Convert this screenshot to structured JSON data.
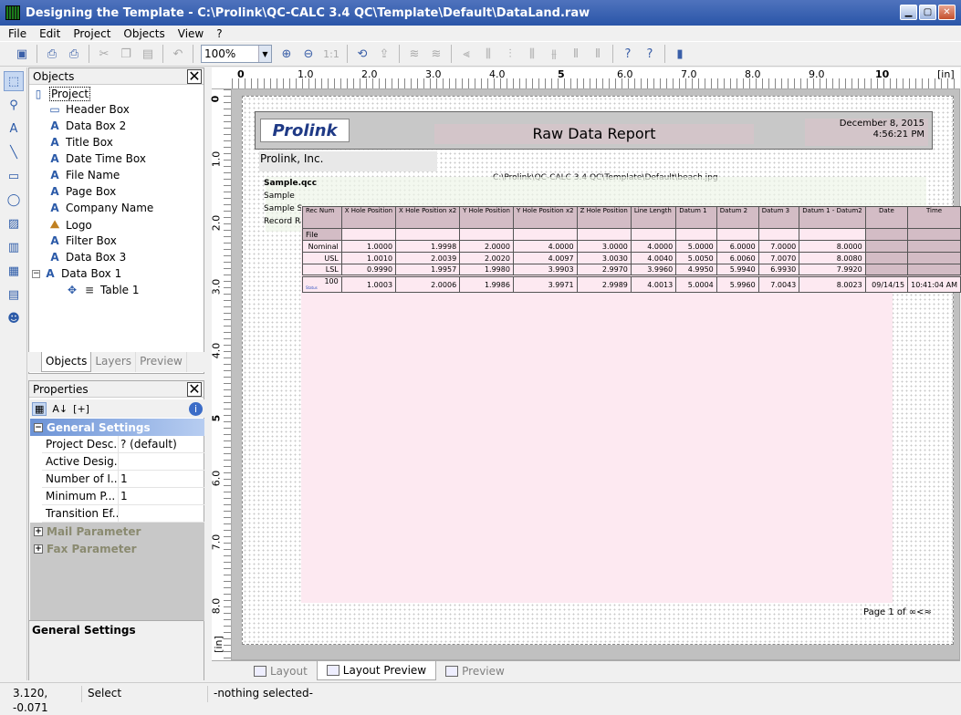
{
  "window": {
    "title": "Designing the Template - C:\\Prolink\\QC-CALC 3.4 QC\\Template\\Default\\DataLand.raw"
  },
  "menu": [
    "File",
    "Edit",
    "Project",
    "Objects",
    "View",
    "?"
  ],
  "toolbar": {
    "zoom": "100%",
    "zoom_ratio": "1:1"
  },
  "objects_panel": {
    "title": "Objects",
    "root": "Project",
    "items": [
      "Header Box",
      "Data Box 2",
      "Title Box",
      "Date Time Box",
      "File Name",
      "Page Box",
      "Company Name",
      "Logo",
      "Filter Box",
      "Data Box 3",
      "Data Box 1"
    ],
    "child": "Table 1",
    "tabs": [
      "Objects",
      "Layers",
      "Preview"
    ]
  },
  "properties_panel": {
    "title": "Properties",
    "categories": [
      "General Settings",
      "Mail Parameter",
      "Fax Parameter"
    ],
    "rows": [
      {
        "key": "Project Desc...",
        "value": "? (default)"
      },
      {
        "key": "Active Desig...",
        "value": ""
      },
      {
        "key": "Number of I...",
        "value": "1"
      },
      {
        "key": "Minimum P...",
        "value": "1"
      },
      {
        "key": "Transition Ef...",
        "value": ""
      }
    ],
    "description_title": "General Settings"
  },
  "ruler": {
    "h": [
      "0",
      "1.0",
      "2.0",
      "3.0",
      "4.0",
      "5",
      "6.0",
      "7.0",
      "8.0",
      "9.0",
      "10"
    ],
    "h_unit": "[in]",
    "v": [
      "0",
      "1.0",
      "2.0",
      "3.0",
      "4.0",
      "5",
      "6.0",
      "7.0",
      "8.0"
    ],
    "v_unit": "[in]"
  },
  "report": {
    "logo": "Prolink",
    "title": "Raw Data Report",
    "date": "December 8, 2015",
    "time": "4:56:21 PM",
    "company": "Prolink, Inc.",
    "file_path": "C:\\Prolink\\QC-CALC 3.4 QC\\Template\\Default\\beach.jpg",
    "sample_file": "Sample.qcc",
    "sample_lines": [
      "Sample",
      "Sample S",
      "Record Ra"
    ],
    "page_footer": "Page 1 of ∞<≈",
    "table": {
      "headers": [
        "Rec Num",
        "X Hole Position",
        "X Hole Position x2",
        "Y Hole Position",
        "Y Hole Position x2",
        "Z Hole Position",
        "Line Length",
        "Datum 1",
        "Datum 2",
        "Datum 3",
        "Datum 1 - Datum2",
        "Date",
        "Time"
      ],
      "file_label": "File",
      "limits": [
        {
          "label": "Nominal",
          "values": [
            "1.0000",
            "1.9998",
            "2.0000",
            "4.0000",
            "3.0000",
            "4.0000",
            "5.0000",
            "6.0000",
            "7.0000",
            "8.0000"
          ]
        },
        {
          "label": "USL",
          "values": [
            "1.0010",
            "2.0039",
            "2.0020",
            "4.0097",
            "3.0030",
            "4.0040",
            "5.0050",
            "6.0060",
            "7.0070",
            "8.0080"
          ]
        },
        {
          "label": "LSL",
          "values": [
            "0.9990",
            "1.9957",
            "1.9980",
            "3.9903",
            "2.9970",
            "3.9960",
            "4.9950",
            "5.9940",
            "6.9930",
            "7.9920"
          ]
        }
      ],
      "record": {
        "num": "100",
        "values": [
          "1.0003",
          "2.0006",
          "1.9986",
          "3.9971",
          "2.9989",
          "4.0013",
          "5.0004",
          "5.9960",
          "7.0043",
          "8.0023"
        ],
        "date": "09/14/15",
        "time": "10:41:04 AM"
      },
      "record_status": "Status"
    }
  },
  "bottom_tabs": [
    "Layout",
    "Layout Preview",
    "Preview"
  ],
  "status": {
    "coords": "3.120, -0.071",
    "mode": "Select",
    "selection": "-nothing selected-"
  }
}
